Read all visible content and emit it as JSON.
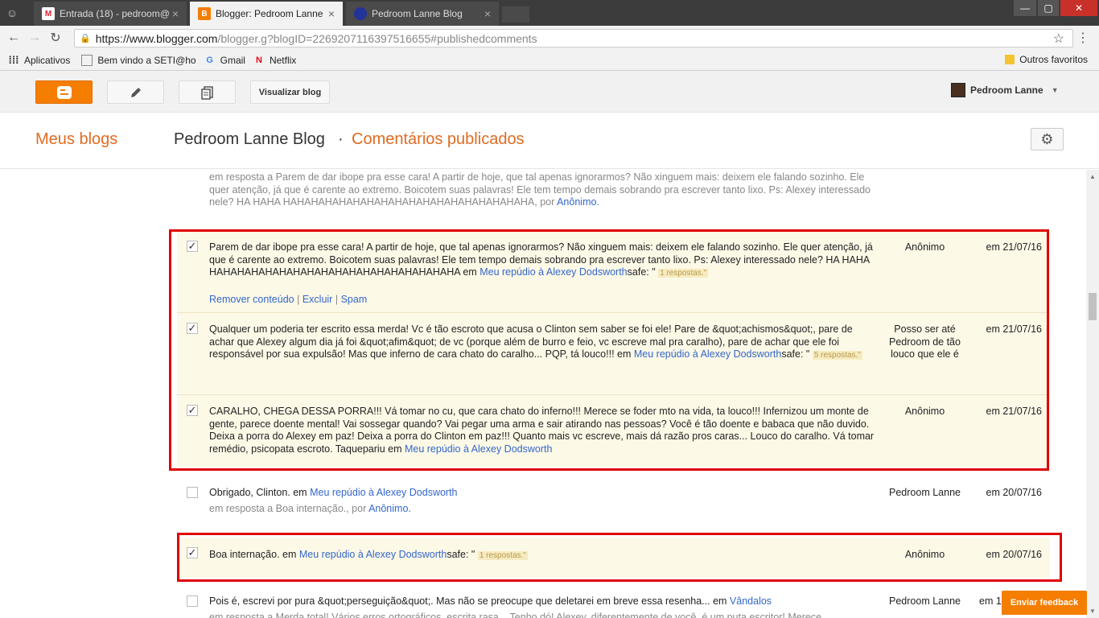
{
  "browser": {
    "tabs": [
      {
        "title": "Entrada (18) - pedroom@",
        "close": "×"
      },
      {
        "title": "Blogger: Pedroom Lanne",
        "close": "×"
      },
      {
        "title": "Pedroom Lanne Blog",
        "close": "×"
      }
    ],
    "url_main": "https://www.blogger.com",
    "url_rest": "/blogger.g?blogID=2269207116397516655#publishedcomments",
    "bookmarks": {
      "apps": "Aplicativos",
      "items": [
        "Bem vindo a SETI@ho",
        "Gmail",
        "Netflix"
      ],
      "other": "Outros favoritos"
    }
  },
  "header": {
    "view_blog": "Visualizar blog",
    "user_name": "Pedroom Lanne"
  },
  "subheader": {
    "my_blogs": "Meus blogs",
    "blog_name": "Pedroom Lanne Blog",
    "separator": "·",
    "section": "Comentários publicados"
  },
  "comments": {
    "top_partial": {
      "text": "em resposta a Parem de dar ibope pra esse cara! A partir de hoje, que tal apenas ignorarmos? Não xinguem mais: deixem ele falando sozinho. Ele quer atenção, já que é carente ao extremo. Boicotem suas palavras! Ele tem tempo demais sobrando pra escrever tanto lixo. Ps: Alexey interessado nele? HA HAHA HAHAHAHAHAHAHAHAHAHAHAHAHAHAHAHAHAHA, por",
      "author_link": "Anônimo."
    },
    "c1": {
      "text": "Parem de dar ibope pra esse cara! A partir de hoje, que tal apenas ignorarmos? Não xinguem mais: deixem ele falando sozinho. Ele quer atenção, já que é carente ao extremo. Boicotem suas palavras! Ele tem tempo demais sobrando pra escrever tanto lixo. Ps: Alexey interessado nele? HA HAHA HAHAHAHAHAHAHAHAHAHAHAHAHAHAHAHAHAHA em",
      "post": "Meu repúdio à Alexey Dodsworth",
      "after": "safe: \"",
      "badge": "1 respostas.\"",
      "author": "Anônimo",
      "date": "em 21/07/16",
      "remove": "Remover conteúdo",
      "delete": "Excluir",
      "spam": "Spam",
      "pipe": "|"
    },
    "c2": {
      "text": "Qualquer um poderia ter escrito essa merda! Vc é tão escroto que acusa o Clinton sem saber se foi ele! Pare de &quot;achismos&quot;, pare de achar que Alexey algum dia já foi &quot;afim&quot; de vc (porque além de burro e feio, vc escreve mal pra caralho), pare de achar que ele foi responsável por sua expulsão! Mas que inferno de cara chato do caralho... PQP, tá louco!!! em",
      "post": "Meu repúdio à Alexey Dodsworth",
      "after": "safe: \"",
      "badge": "5 respostas.\"",
      "author": "Posso ser até Pedroom de tão louco que ele é",
      "date": "em 21/07/16"
    },
    "c3": {
      "text": "CARALHO, CHEGA DESSA PORRA!!! Vá tomar no cu, que cara chato do inferno!!! Merece se foder mto na vida, ta louco!!! Infernizou um monte de gente, parece doente mental! Vai sossegar quando? Vai pegar uma arma e sair atirando nas pessoas? Você é tão doente e babaca que não duvido. Deixa a porra do Alexey em paz! Deixa a porra do Clinton em paz!!! Quanto mais vc escreve, mais dá razão pros caras... Louco do caralho. Vá tomar remédio, psicopata escroto. Taquepariu em",
      "post": "Meu repúdio à Alexey Dodsworth",
      "author": "Anônimo",
      "date": "em 21/07/16"
    },
    "c4": {
      "text": "Obrigado, Clinton. em",
      "post": "Meu repúdio à Alexey Dodsworth",
      "reply": "em resposta a Boa internação., por",
      "reply_author": "Anônimo.",
      "author": "Pedroom Lanne",
      "date": "em 20/07/16"
    },
    "c5": {
      "text": "Boa internação. em",
      "post": "Meu repúdio à Alexey Dodsworth",
      "after": "safe: \"",
      "badge": "1 respostas.\"",
      "author": "Anônimo",
      "date": "em 20/07/16"
    },
    "c6": {
      "text": "Pois é, escrevi por pura &quot;perseguição&quot;. Mas não se preocupe que deletarei em breve essa resenha... em",
      "post": "Vândalos",
      "reply": "em resposta a Merda total! Vários erros ortográficos, escrita rasa... Tenho dó! Alexey, diferentemente de você, é um puta escritor! Merece",
      "author": "Pedroom Lanne",
      "date": "em 1"
    }
  },
  "feedback": "Enviar feedback",
  "checkmark": "✓",
  "colors": {
    "accent": "#f57d00",
    "link": "#3366cc",
    "selection_bg": "#fdf9e7",
    "highlight_border": "#e00000"
  }
}
